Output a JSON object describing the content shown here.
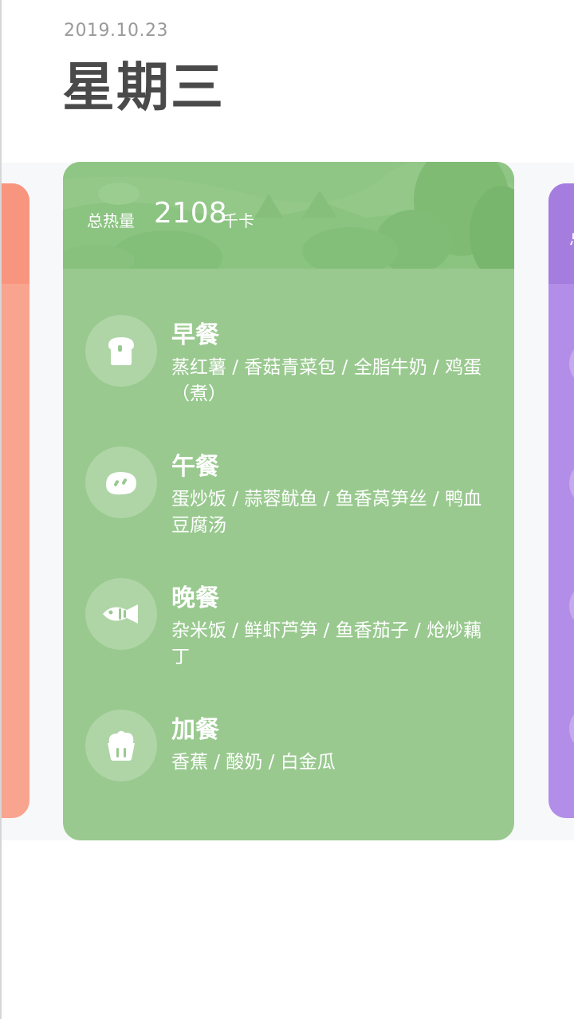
{
  "header": {
    "date": "2019.10.23",
    "weekday": "星期三"
  },
  "card": {
    "kcal_label": "总热量",
    "kcal_value": "2108",
    "kcal_unit": "千卡"
  },
  "meals": [
    {
      "title": "早餐",
      "icon": "toast-icon",
      "items": "蒸红薯 / 香菇青菜包 / 全脂牛奶 / 鸡蛋（煮）"
    },
    {
      "title": "午餐",
      "icon": "bean-icon",
      "items": "蛋炒饭 / 蒜蓉鱿鱼 / 鱼香莴笋丝 / 鸭血豆腐汤"
    },
    {
      "title": "晚餐",
      "icon": "fish-icon",
      "items": "杂米饭 / 鲜虾芦笋 / 鱼香茄子 / 炝炒藕丁"
    },
    {
      "title": "加餐",
      "icon": "muffin-icon",
      "items": "香蕉 / 酸奶 / 白金瓜"
    }
  ],
  "side_cards": {
    "right_label_char": "总"
  },
  "colors": {
    "card_main": "#99c98f",
    "card_left": "#f9a48f",
    "card_right": "#b28ee8"
  }
}
